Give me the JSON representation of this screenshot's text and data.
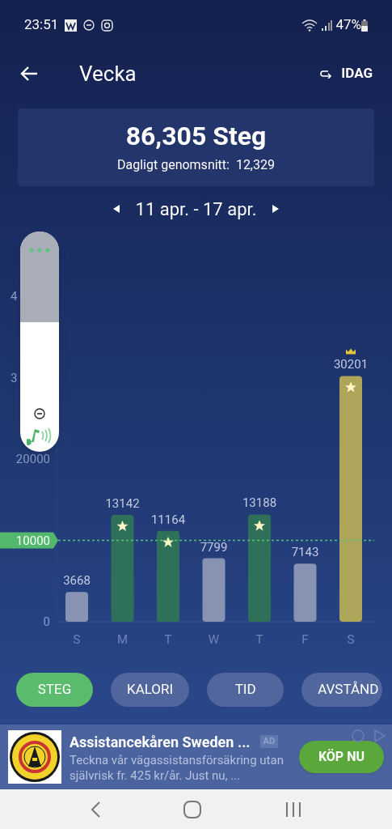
{
  "status_bar": {
    "time": "23:51",
    "battery": "47%"
  },
  "header": {
    "title": "Vecka",
    "today_button": "IDAG"
  },
  "summary": {
    "total": "86,305 Steg",
    "average": "Dagligt genomsnitt:  12,329"
  },
  "date_range": "11 apr. - 17 apr.",
  "chart_data": {
    "type": "bar",
    "categories": [
      "S",
      "M",
      "T",
      "W",
      "T",
      "F",
      "S"
    ],
    "values": [
      3668,
      13142,
      11164,
      7799,
      13188,
      7143,
      30201
    ],
    "data_labels": true,
    "ylim": [
      0,
      40000
    ],
    "yticks": [
      {
        "value": 0,
        "label": "0"
      },
      {
        "value": 10000,
        "label": "10000"
      },
      {
        "value": 20000,
        "label": "20000"
      }
    ],
    "ref_lines": [
      {
        "axis": "y",
        "value": 10000
      }
    ]
  },
  "covered_axis_labels": [
    "4",
    "3"
  ],
  "tabs": [
    {
      "label": "STEG",
      "selected": true
    },
    {
      "label": "KALORI",
      "selected": false
    },
    {
      "label": "TID",
      "selected": false
    },
    {
      "label": "AVSTÅND",
      "selected": false
    }
  ],
  "ad": {
    "title": "Assistancekåren Sweden ...",
    "badge": "AD",
    "text": "Teckna vår vägassistansförsäkring utan självrisk fr. 425 kr/år. Just nu, ...",
    "button": "KÖP NU"
  }
}
